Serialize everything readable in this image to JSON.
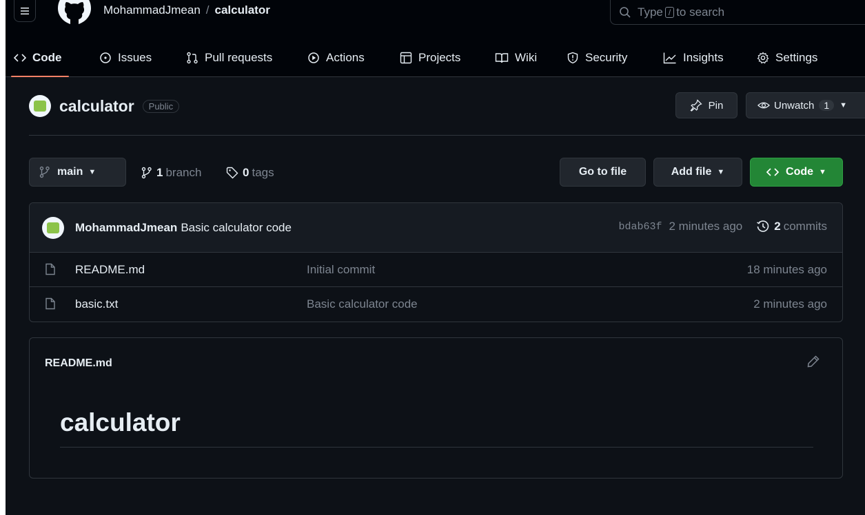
{
  "header": {
    "owner": "MohammadJmean",
    "separator": "/",
    "repo": "calculator",
    "search": {
      "prefix": "Type",
      "key": "/",
      "suffix": "to search"
    }
  },
  "repo_nav": {
    "tabs": [
      {
        "label": "Code",
        "icon": "code-icon",
        "active": true
      },
      {
        "label": "Issues",
        "icon": "issue-icon"
      },
      {
        "label": "Pull requests",
        "icon": "pull-request-icon"
      },
      {
        "label": "Actions",
        "icon": "play-icon"
      },
      {
        "label": "Projects",
        "icon": "table-icon"
      },
      {
        "label": "Wiki",
        "icon": "book-icon"
      },
      {
        "label": "Security",
        "icon": "shield-icon"
      },
      {
        "label": "Insights",
        "icon": "graph-icon"
      },
      {
        "label": "Settings",
        "icon": "gear-icon"
      }
    ]
  },
  "repo_header": {
    "name": "calculator",
    "visibility": "Public",
    "pin_label": "Pin",
    "watch_label": "Unwatch",
    "watch_count": "1"
  },
  "branch_bar": {
    "branch": "main",
    "branch_count": "1",
    "branch_word": "branch",
    "tag_count": "0",
    "tag_word": "tags",
    "go_to_file": "Go to file",
    "add_file": "Add file",
    "code_button": "Code"
  },
  "latest_commit": {
    "author": "MohammadJmean",
    "message": "Basic calculator code",
    "sha": "bdab63f",
    "age": "2 minutes ago",
    "commit_count": "2",
    "commit_word": "commits"
  },
  "files": [
    {
      "name": "README.md",
      "message": "Initial commit",
      "age": "18 minutes ago"
    },
    {
      "name": "basic.txt",
      "message": "Basic calculator code",
      "age": "2 minutes ago"
    }
  ],
  "readme": {
    "filename": "README.md",
    "heading": "calculator"
  },
  "colors": {
    "background": "#0d1117",
    "accent_underline": "#f78166",
    "green_button": "#238636",
    "border": "#30363d",
    "muted_text": "#7d8590"
  }
}
